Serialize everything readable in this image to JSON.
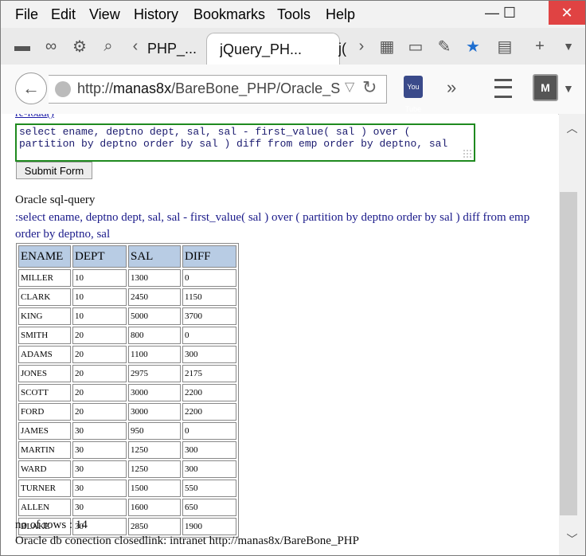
{
  "menu": [
    "File",
    "Edit",
    "View",
    "History",
    "Bookmarks",
    "Tools",
    "Help"
  ],
  "window_controls": {
    "minimize": "—",
    "maximize": "☐",
    "close": "✕"
  },
  "tabs": [
    {
      "label": "PHP_..."
    },
    {
      "label": "jQuery_PH..."
    },
    {
      "label": "j("
    }
  ],
  "toolbar_icons": {
    "folder": "folder-icon",
    "mask": "mask-icon",
    "gear": "gear-icon",
    "search": "search-icon"
  },
  "url": {
    "host": "http://",
    "bold": "manas8x",
    "path": "/BareBone_PHP/Oracle_SQ"
  },
  "youtube_label": "You Tube",
  "shield_label": "M",
  "page": {
    "reload_link": "re-load()",
    "query_line1": "select ename, deptno dept, sal, sal - first_value( sal ) over (",
    "query_line2": "partition by deptno order by sal ) diff from emp order by deptno, sal",
    "submit_label": "Submit Form",
    "section_label": "Oracle sql-query",
    "query_echo": ":select ename, deptno dept, sal, sal - first_value( sal ) over ( partition by deptno order by sal ) diff from emp order by deptno, sal",
    "rows_count": "no of rows : 14",
    "footer": "Oracle db conection closedlink: intranet http://manas8x/BareBone_PHP"
  },
  "table": {
    "headers": [
      "ENAME",
      "DEPT",
      "SAL",
      "DIFF"
    ],
    "rows": [
      [
        "MILLER",
        "10",
        "1300",
        "0"
      ],
      [
        "CLARK",
        "10",
        "2450",
        "1150"
      ],
      [
        "KING",
        "10",
        "5000",
        "3700"
      ],
      [
        "SMITH",
        "20",
        "800",
        "0"
      ],
      [
        "ADAMS",
        "20",
        "1100",
        "300"
      ],
      [
        "JONES",
        "20",
        "2975",
        "2175"
      ],
      [
        "SCOTT",
        "20",
        "3000",
        "2200"
      ],
      [
        "FORD",
        "20",
        "3000",
        "2200"
      ],
      [
        "JAMES",
        "30",
        "950",
        "0"
      ],
      [
        "MARTIN",
        "30",
        "1250",
        "300"
      ],
      [
        "WARD",
        "30",
        "1250",
        "300"
      ],
      [
        "TURNER",
        "30",
        "1500",
        "550"
      ],
      [
        "ALLEN",
        "30",
        "1600",
        "650"
      ],
      [
        "BLAKE",
        "30",
        "2850",
        "1900"
      ]
    ]
  }
}
